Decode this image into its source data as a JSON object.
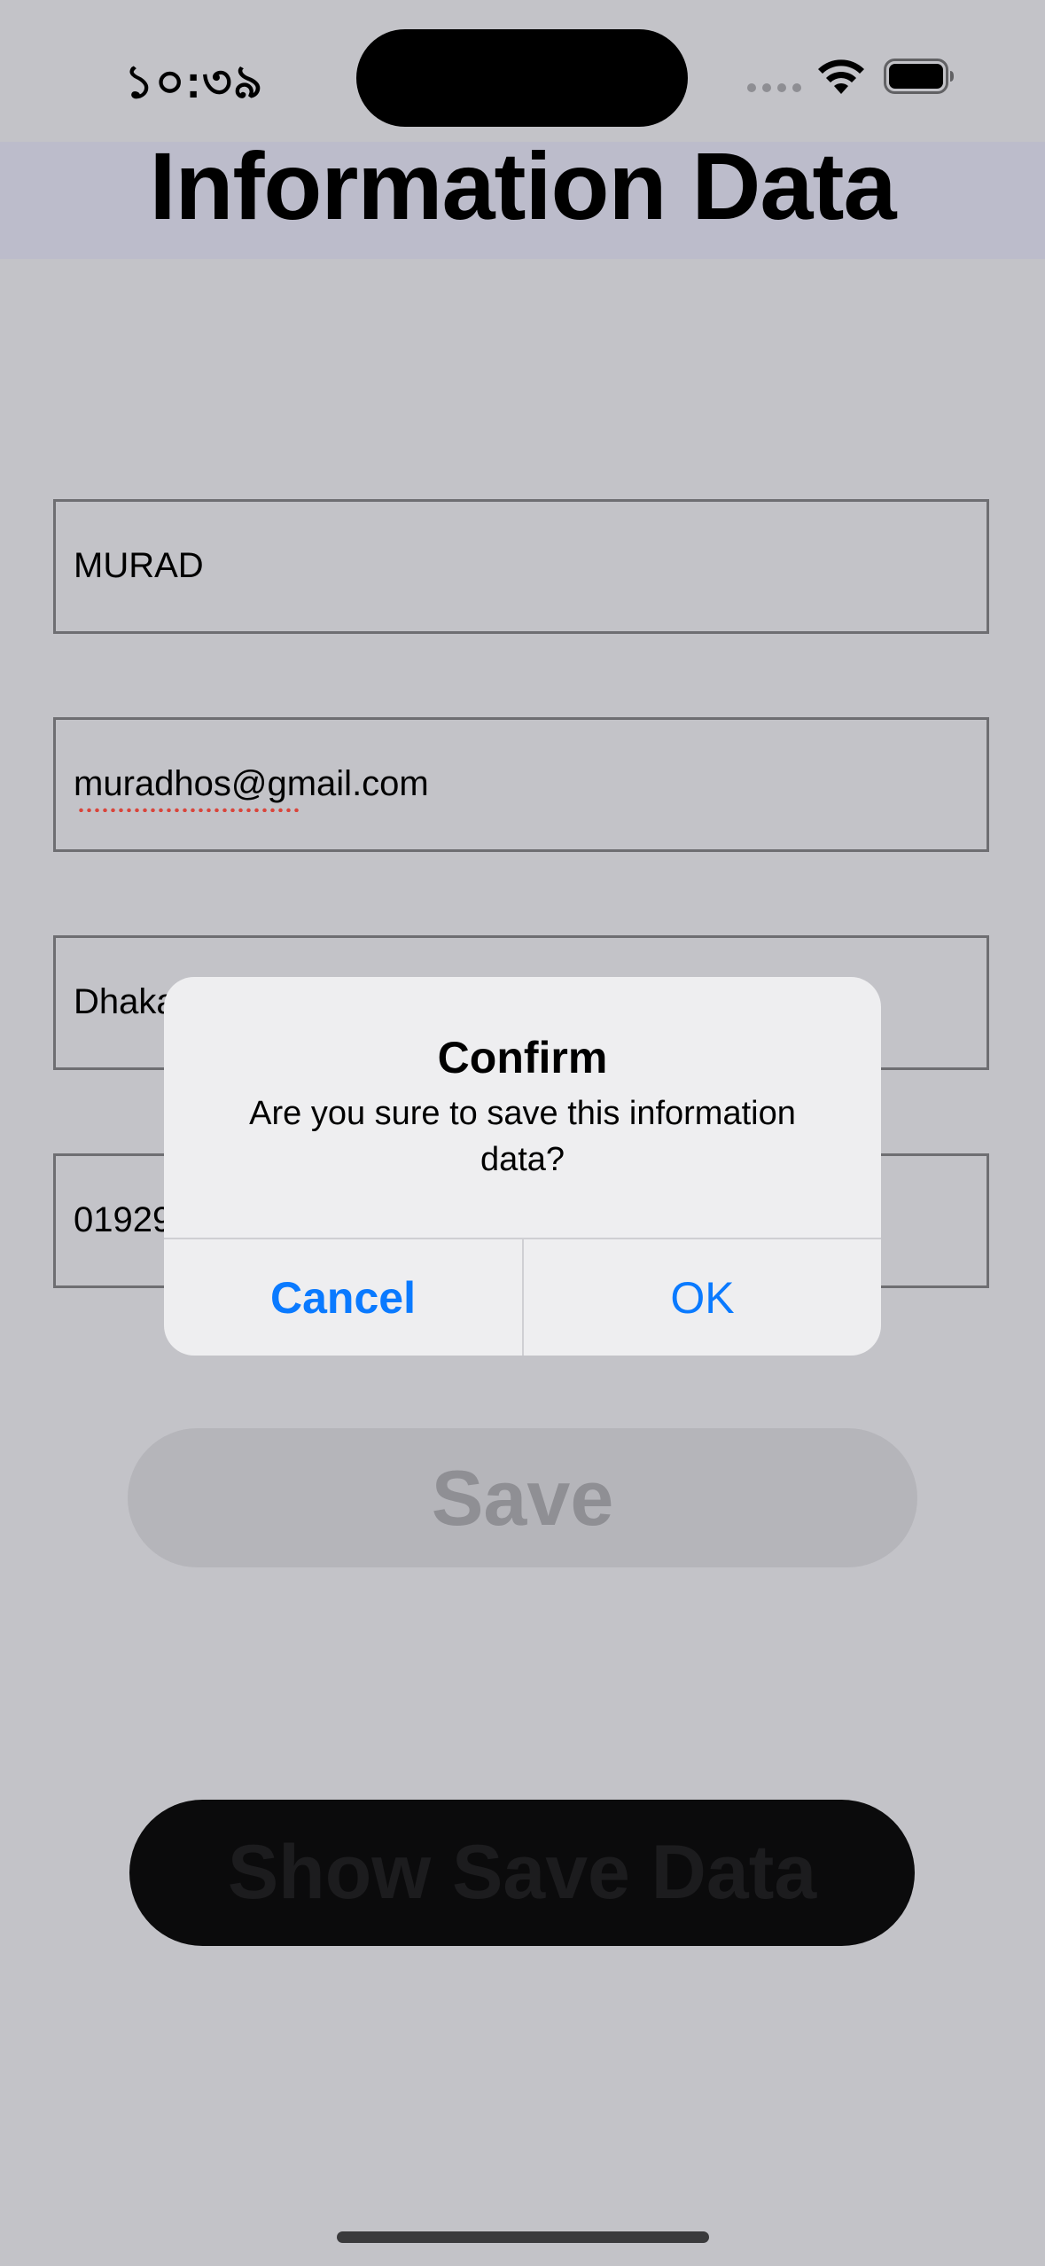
{
  "status_bar": {
    "time": "১০:৩৯",
    "icons": [
      "signal-dots-icon",
      "wifi-icon",
      "battery-icon"
    ]
  },
  "header": {
    "title": "Information Data"
  },
  "form": {
    "name_value": "MURAD",
    "email_value": "muradhos@gmail.com",
    "address_value": "Dhaka",
    "phone_value": "01929"
  },
  "buttons": {
    "save_label": "Save",
    "show_label": "Show Save Data"
  },
  "alert": {
    "title": "Confirm",
    "message": "Are you sure to save this information data?",
    "cancel_label": "Cancel",
    "ok_label": "OK"
  },
  "colors": {
    "background": "#c3c3c8",
    "alert_background": "#eeeef0",
    "accent": "#0a7aff",
    "spellcheck": "#d9453b"
  }
}
